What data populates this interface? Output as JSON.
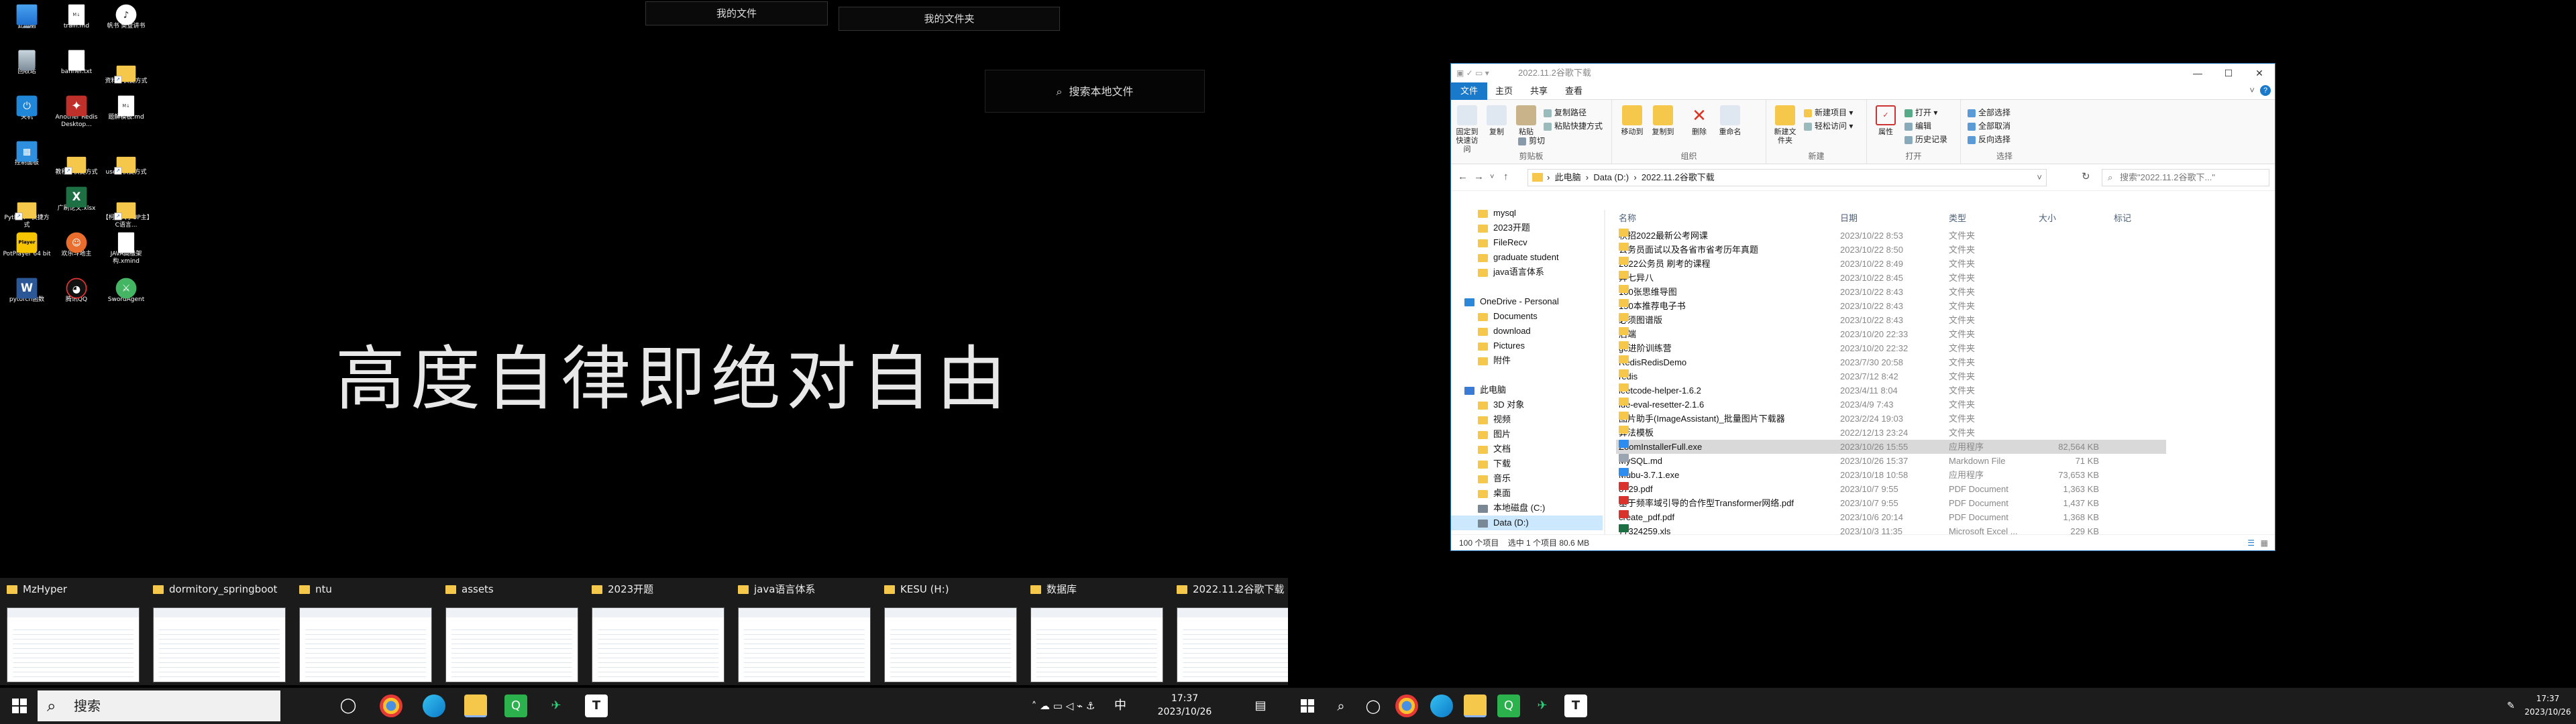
{
  "desktop_icons": [
    {
      "label": "此电脑",
      "icon": "computer-icon",
      "glyph": ""
    },
    {
      "label": "train.md",
      "icon": "markdown-file-icon",
      "glyph": "M↓"
    },
    {
      "label": "帆书 樊登讲书",
      "icon": "fanshu-app-icon",
      "glyph": "♪"
    },
    {
      "label": "回收站",
      "icon": "recycle-bin-icon",
      "glyph": ""
    },
    {
      "label": "banner.txt",
      "icon": "text-file-icon",
      "glyph": ""
    },
    {
      "label": "资料 - 快捷方式",
      "icon": "folder-shortcut-icon",
      "glyph": ""
    },
    {
      "label": "关机",
      "icon": "shutdown-icon",
      "glyph": "⏻"
    },
    {
      "label": "Another Redis Desktop...",
      "icon": "redis-desktop-icon",
      "glyph": "✦"
    },
    {
      "label": "题解模板.md",
      "icon": "markdown-file-icon",
      "glyph": "M↓"
    },
    {
      "label": "控制面板",
      "icon": "control-panel-icon",
      "glyph": "▦"
    },
    {
      "label": "教程 - 快捷方式",
      "icon": "folder-shortcut-icon",
      "glyph": ""
    },
    {
      "label": "use - 快捷方式",
      "icon": "folder-shortcut-icon",
      "glyph": ""
    },
    {
      "label": "Python - 快捷方式",
      "icon": "folder-shortcut-icon",
      "glyph": ""
    },
    {
      "label": "广刷论文.xlsx",
      "icon": "excel-file-icon",
      "glyph": "X"
    },
    {
      "label": "【柯哩大学UP主】C语言...",
      "icon": "folder-shortcut-icon",
      "glyph": ""
    },
    {
      "label": "PotPlayer 64 bit",
      "icon": "potplayer-icon",
      "glyph": "Player"
    },
    {
      "label": "欢乐斗地主",
      "icon": "game-icon",
      "glyph": "☺"
    },
    {
      "label": "JAVA高级架构.xmind",
      "icon": "xmind-file-icon",
      "glyph": ""
    },
    {
      "label": "pytorch函数",
      "icon": "word-file-icon",
      "glyph": "W"
    },
    {
      "label": "腾讯QQ",
      "icon": "qq-icon",
      "glyph": "◕"
    },
    {
      "label": "SwordAgent",
      "icon": "swordagent-icon",
      "glyph": "⚔"
    }
  ],
  "top_buttons": {
    "my_files": "我的文件",
    "my_folder": "我的文件夹"
  },
  "motto": "高度自律即绝对自由",
  "local_search": {
    "icon": "search-icon",
    "label": "搜索本地文件"
  },
  "task_view": [
    {
      "title": "MzHyper"
    },
    {
      "title": "dormitory_springboot"
    },
    {
      "title": "ntu"
    },
    {
      "title": "assets"
    },
    {
      "title": "2023开题"
    },
    {
      "title": "java语言体系"
    },
    {
      "title": "KESU (H:)"
    },
    {
      "title": "数据库"
    },
    {
      "title": "2022.11.2谷歌下载"
    }
  ],
  "taskbar": {
    "search_placeholder": "搜索",
    "time": "17:37",
    "date": "2023/10/26",
    "lang": "中",
    "pinned": [
      "task-view-icon",
      "chrome-icon",
      "edge-icon",
      "file-explorer-icon",
      "qq-browser-icon",
      "feishu-icon",
      "typora-icon"
    ]
  },
  "taskbar2": {
    "time": "17:37",
    "date": "2023/10/26"
  },
  "explorer": {
    "title": "2022.11.2谷歌下载",
    "tabs": [
      "文件",
      "主页",
      "共享",
      "查看"
    ],
    "ribbon": {
      "clipboard": {
        "pin": "固定到快速访问",
        "copy": "复制",
        "paste": "粘贴",
        "copy_path": "复制路径",
        "paste_shortcut": "粘贴快捷方式",
        "cut": "剪切",
        "label": "剪贴板"
      },
      "organize": {
        "move_to": "移动到",
        "copy_to": "复制到",
        "delete": "删除",
        "rename": "重命名",
        "label": "组织"
      },
      "new": {
        "new_folder": "新建文件夹",
        "new_item": "新建项目",
        "easy_access": "轻松访问",
        "label": "新建"
      },
      "open": {
        "properties": "属性",
        "open": "打开",
        "edit": "编辑",
        "history": "历史记录",
        "label": "打开"
      },
      "select": {
        "select_all": "全部选择",
        "select_none": "全部取消",
        "invert": "反向选择",
        "label": "选择"
      }
    },
    "breadcrumb": [
      "此电脑",
      "Data (D:)",
      "2022.11.2谷歌下载"
    ],
    "search_placeholder": "搜索\"2022.11.2谷歌下...\"",
    "nav": [
      {
        "label": "mysql",
        "type": "folder"
      },
      {
        "label": "2023开题",
        "type": "folder"
      },
      {
        "label": "FileRecv",
        "type": "folder"
      },
      {
        "label": "graduate student",
        "type": "folder"
      },
      {
        "label": "java语言体系",
        "type": "folder"
      },
      {
        "label": "",
        "type": "spacer"
      },
      {
        "label": "OneDrive - Personal",
        "type": "cloud"
      },
      {
        "label": "Documents",
        "type": "folder"
      },
      {
        "label": "download",
        "type": "folder"
      },
      {
        "label": "Pictures",
        "type": "folder"
      },
      {
        "label": "附件",
        "type": "folder"
      },
      {
        "label": "",
        "type": "spacer"
      },
      {
        "label": "此电脑",
        "type": "pc"
      },
      {
        "label": "3D 对象",
        "type": "folder"
      },
      {
        "label": "视频",
        "type": "folder"
      },
      {
        "label": "图片",
        "type": "folder"
      },
      {
        "label": "文档",
        "type": "folder"
      },
      {
        "label": "下载",
        "type": "folder"
      },
      {
        "label": "音乐",
        "type": "folder"
      },
      {
        "label": "桌面",
        "type": "folder"
      },
      {
        "label": "本地磁盘 (C:)",
        "type": "drive"
      },
      {
        "label": "Data (D:)",
        "type": "drive"
      }
    ],
    "columns": {
      "name": "名称",
      "date": "日期",
      "type": "类型",
      "size": "大小",
      "tags": "标记"
    },
    "files": [
      {
        "name": "秋招2022最新公考网课",
        "date": "2023/10/22 8:53",
        "type": "文件夹",
        "size": "",
        "kind": "folder"
      },
      {
        "name": "公务员面试以及各省市省考历年真题",
        "date": "2023/10/22 8:50",
        "type": "文件夹",
        "size": "",
        "kind": "folder"
      },
      {
        "name": "2022公务员 刷考的课程",
        "date": "2023/10/22 8:49",
        "type": "文件夹",
        "size": "",
        "kind": "folder"
      },
      {
        "name": "异七异八",
        "date": "2023/10/22 8:45",
        "type": "文件夹",
        "size": "",
        "kind": "folder"
      },
      {
        "name": "100张思维导图",
        "date": "2023/10/22 8:43",
        "type": "文件夹",
        "size": "",
        "kind": "folder"
      },
      {
        "name": "150本推荐电子书",
        "date": "2023/10/22 8:43",
        "type": "文件夹",
        "size": "",
        "kind": "folder"
      },
      {
        "name": "必须图谱版",
        "date": "2023/10/22 8:43",
        "type": "文件夹",
        "size": "",
        "kind": "folder"
      },
      {
        "name": "后端",
        "date": "2023/10/20 22:33",
        "type": "文件夹",
        "size": "",
        "kind": "folder"
      },
      {
        "name": "gc进阶训练营",
        "date": "2023/10/20 22:32",
        "type": "文件夹",
        "size": "",
        "kind": "folder"
      },
      {
        "name": "RedisRedisDemo",
        "date": "2023/7/30 20:58",
        "type": "文件夹",
        "size": "",
        "kind": "folder"
      },
      {
        "name": "redis",
        "date": "2023/7/12 8:42",
        "type": "文件夹",
        "size": "",
        "kind": "folder"
      },
      {
        "name": "leetcode-helper-1.6.2",
        "date": "2023/4/11 8:04",
        "type": "文件夹",
        "size": "",
        "kind": "folder"
      },
      {
        "name": "ide-eval-resetter-2.1.6",
        "date": "2023/4/9 7:43",
        "type": "文件夹",
        "size": "",
        "kind": "folder"
      },
      {
        "name": "图片助手(ImageAssistant)_批量图片下载器",
        "date": "2023/2/24 19:03",
        "type": "文件夹",
        "size": "",
        "kind": "folder"
      },
      {
        "name": "算法模板",
        "date": "2022/12/13 23:24",
        "type": "文件夹",
        "size": "",
        "kind": "folder"
      },
      {
        "name": "ZoomInstallerFull.exe",
        "date": "2023/10/26 15:55",
        "type": "应用程序",
        "size": "82,564 KB",
        "kind": "exe"
      },
      {
        "name": "MySQL.md",
        "date": "2023/10/26 15:37",
        "type": "Markdown File",
        "size": "71 KB",
        "kind": "md"
      },
      {
        "name": "Mubu-3.7.1.exe",
        "date": "2023/10/18 10:58",
        "type": "应用程序",
        "size": "73,653 KB",
        "kind": "exe"
      },
      {
        "name": "8729.pdf",
        "date": "2023/10/7 9:55",
        "type": "PDF Document",
        "size": "1,363 KB",
        "kind": "pdf"
      },
      {
        "name": "基于频率域引导的合作型Transformer网络.pdf",
        "date": "2023/10/7 9:55",
        "type": "PDF Document",
        "size": "1,437 KB",
        "kind": "pdf"
      },
      {
        "name": "create_pdf.pdf",
        "date": "2023/10/6 20:14",
        "type": "PDF Document",
        "size": "1,368 KB",
        "kind": "pdf"
      },
      {
        "name": "77324259.xls",
        "date": "2023/10/3 11:35",
        "type": "Microsoft Excel ...",
        "size": "229 KB",
        "kind": "xls"
      }
    ],
    "status": {
      "count": "100 个项目",
      "selected": "选中 1 个项目  80.6 MB"
    }
  }
}
